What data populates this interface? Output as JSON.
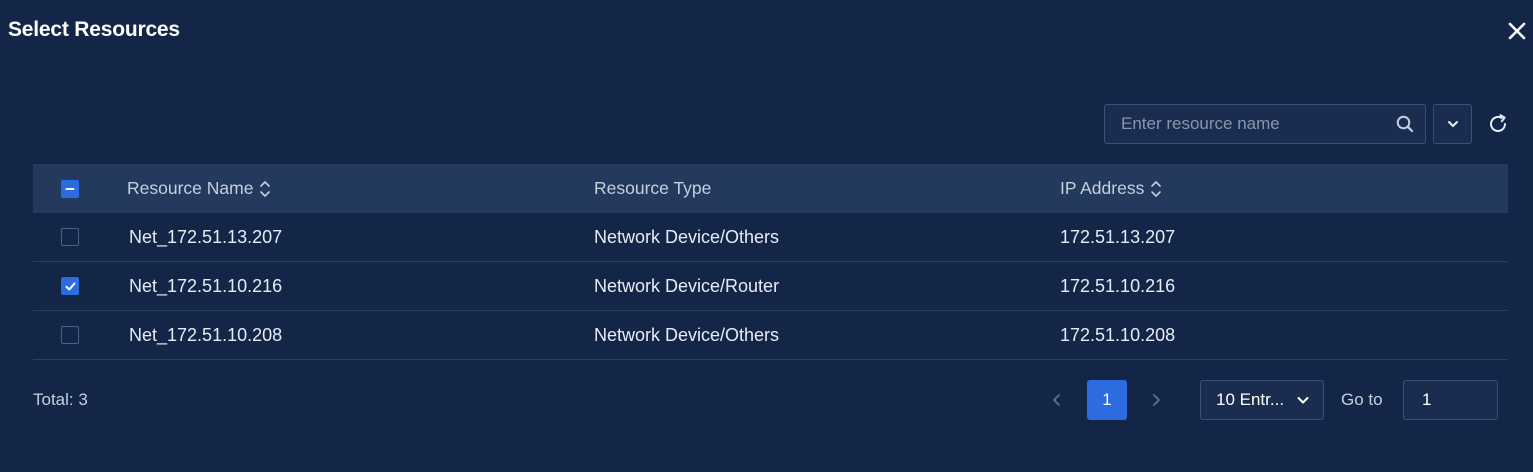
{
  "dialog": {
    "title": "Select Resources"
  },
  "toolbar": {
    "search_placeholder": "Enter resource name",
    "search_value": ""
  },
  "table": {
    "columns": {
      "name": "Resource Name",
      "type": "Resource Type",
      "ip": "IP Address"
    },
    "rows": [
      {
        "name": "Net_172.51.13.207",
        "type": "Network Device/Others",
        "ip": "172.51.13.207",
        "checked": false
      },
      {
        "name": "Net_172.51.10.216",
        "type": "Network Device/Router",
        "ip": "172.51.10.216",
        "checked": true
      },
      {
        "name": "Net_172.51.10.208",
        "type": "Network Device/Others",
        "ip": "172.51.10.208",
        "checked": false
      }
    ]
  },
  "pagination": {
    "total": "Total: 3",
    "current_page": "1",
    "page_size": "10 Entr...",
    "goto_label": "Go to",
    "goto_value": "1"
  },
  "colors": {
    "background": "#142647",
    "header_row": "#233a5e",
    "accent": "#2c6be0"
  },
  "icons": {
    "close": "close-icon",
    "search": "search-icon",
    "dropdown": "chevron-down-icon",
    "refresh": "refresh-icon",
    "sort": "sort-icon",
    "prev": "chevron-left-icon",
    "next": "chevron-right-icon"
  }
}
